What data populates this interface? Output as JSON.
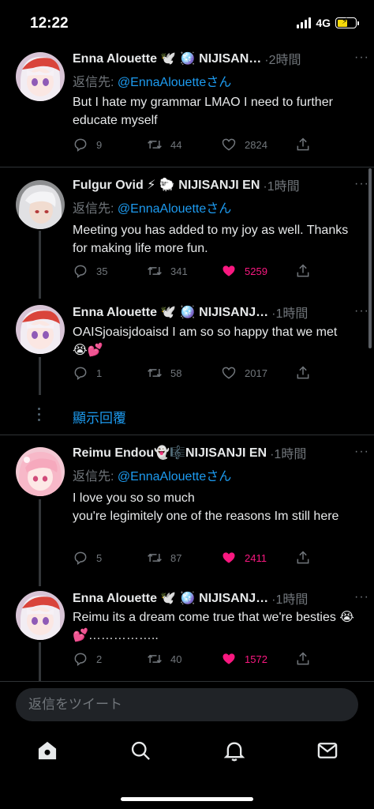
{
  "status": {
    "time": "12:22",
    "network": "4G"
  },
  "tweets": [
    {
      "name": "Enna Alouette 🕊️ 🪩 NIJISAN…",
      "time": "·2時間",
      "reply_prefix": "返信先: ",
      "reply_handle": "@EnnaAlouetteさん",
      "text": "But I hate my grammar LMAO I need to further educate myself",
      "replies": "9",
      "retweets": "44",
      "likes": "2824",
      "liked": false
    },
    {
      "name": "Fulgur Ovid ⚡ 🐑 NIJISANJI EN",
      "time": "·1時間",
      "reply_prefix": "返信先: ",
      "reply_handle": "@EnnaAlouetteさん",
      "text": "Meeting you has added to my joy as well. Thanks for making life more fun.",
      "replies": "35",
      "retweets": "341",
      "likes": "5259",
      "liked": true
    },
    {
      "name": "Enna Alouette 🕊️ 🪩 NIJISANJ…",
      "time": "·1時間",
      "text": "OAISjoaisjdoaisd I am so so happy that we met 😭💕",
      "replies": "1",
      "retweets": "58",
      "likes": "2017",
      "liked": false
    },
    {
      "name": "Reimu Endou👻🎼NIJISANJI EN",
      "time": "·1時間",
      "reply_prefix": "返信先: ",
      "reply_handle": "@EnnaAlouetteさん",
      "text_line1": "I love you so so much",
      "text_line2": "you're legimitely one of the reasons Im still here",
      "replies": "5",
      "retweets": "87",
      "likes": "2411",
      "liked": true
    },
    {
      "name": "Enna Alouette 🕊️ 🪩 NIJISANJ…",
      "time": "·1時間",
      "text": "Reimu its a dream come true that we're besties 😭💕……………..",
      "replies": "2",
      "retweets": "40",
      "likes": "1572",
      "liked": true
    }
  ],
  "show_replies": "顯示回覆",
  "reply_placeholder": "返信をツイート",
  "more_label": "···",
  "tabs": [
    "home-icon",
    "search-icon",
    "notifications-icon",
    "messages-icon"
  ],
  "colors": {
    "accent": "#1d9bf0",
    "like": "#f91880",
    "muted": "#71767b",
    "background": "#000000"
  }
}
